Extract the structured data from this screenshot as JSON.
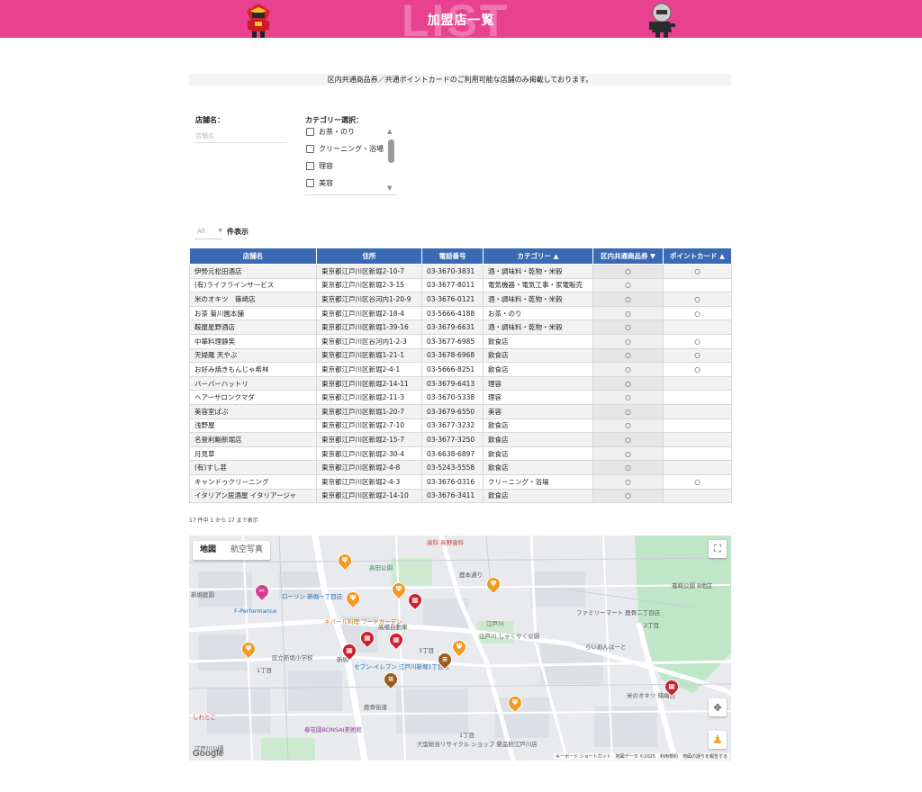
{
  "header": {
    "title": "加盟店一覧",
    "ghost_text": "LIST",
    "color": "#e8418f"
  },
  "notice": "区内共通商品券／共通ポイントカードのご利用可能な店舗のみ掲載しております。",
  "filters": {
    "name_label": "店舗名：",
    "name_placeholder": "店舗名",
    "category_label": "カテゴリー選択：",
    "categories": [
      "お茶・のり",
      "クリーニング・浴場",
      "理容",
      "美容"
    ]
  },
  "length": {
    "value": "All",
    "suffix": "件表示"
  },
  "table": {
    "headers": [
      "店舗名",
      "住所",
      "電話番号",
      "カテゴリー",
      "区内共通商品券",
      "ポイントカード"
    ],
    "rows": [
      [
        "伊勢元松田酒店",
        "東京都江戸川区新堀2-10-7",
        "03-3670-3831",
        "酒・調味料・乾物・米穀",
        "○",
        "○"
      ],
      [
        "(有)ライフラインサービス",
        "東京都江戸川区新堀2-3-15",
        "03-3677-8011",
        "電気機器・電気工事・家電販売",
        "○",
        ""
      ],
      [
        "米のオキツ　篠崎店",
        "東京都江戸川区谷河内1-20-9",
        "03-3676-0121",
        "酒・調味料・乾物・米穀",
        "○",
        "○"
      ],
      [
        "お茶 菊川園本舗",
        "東京都江戸川区新堀2-18-4",
        "03-5666-4188",
        "お茶・のり",
        "○",
        "○"
      ],
      [
        "鞍屋星野酒店",
        "東京都江戸川区新堀1-39-16",
        "03-3679-6631",
        "酒・調味料・乾物・米穀",
        "○",
        ""
      ],
      [
        "中華料理静笑",
        "東京都江戸川区谷河内1-2-3",
        "03-3677-6985",
        "飲食店",
        "○",
        "○"
      ],
      [
        "天婦羅 天やぶ",
        "東京都江戸川区新堀1-21-1",
        "03-3678-6968",
        "飲食店",
        "○",
        "○"
      ],
      [
        "お好み焼きもんじゃ希林",
        "東京都江戸川区新堀2-4-1",
        "03-5666-8251",
        "飲食店",
        "○",
        "○"
      ],
      [
        "バーバーハットリ",
        "東京都江戸川区新堀2-14-11",
        "03-3679-6413",
        "理容",
        "○",
        ""
      ],
      [
        "ヘアーサロンクマダ",
        "東京都江戸川区新堀2-11-3",
        "03-3670-5338",
        "理容",
        "○",
        ""
      ],
      [
        "美容室ぱぶ",
        "東京都江戸川区新堀1-20-7",
        "03-3679-6550",
        "美容",
        "○",
        ""
      ],
      [
        "浅野屋",
        "東京都江戸川区新堀2-7-10",
        "03-3677-3232",
        "飲食店",
        "○",
        ""
      ],
      [
        "名登利鮨新堀店",
        "東京都江戸川区新堀2-15-7",
        "03-3677-3250",
        "飲食店",
        "○",
        ""
      ],
      [
        "月見草",
        "東京都江戸川区新堀2-30-4",
        "03-6638-6897",
        "飲食店",
        "○",
        ""
      ],
      [
        "(有)すし甚",
        "東京都江戸川区新堀2-4-8",
        "03-5243-5558",
        "飲食店",
        "○",
        ""
      ],
      [
        "キャンドゥクリーニング",
        "東京都江戸川区新堀2-4-3",
        "03-3676-0316",
        "クリーニング・浴場",
        "○",
        "○"
      ],
      [
        "イタリアン居酒屋 イタリアージャ",
        "東京都江戸川区新堀2-14-10",
        "03-3676-3411",
        "飲食店",
        "○",
        ""
      ]
    ],
    "header_color": "#3a6ab3"
  },
  "info": "17 件中 1 から 17 まで表示",
  "map": {
    "tabs": [
      "地図",
      "航空写真"
    ],
    "labels": {
      "l1": "歯科 長野歯科",
      "l2": "高田公園",
      "l3": "ローソン 新堀一丁目店",
      "l4": "F-Performance",
      "l5": "ネパール料理 フードガーデン",
      "l6": "高橋自動車",
      "l7": "江戸川 しゃくやく公園",
      "l8": "ファミリーマート 鹿骨二丁目店",
      "l9": "篠崎公園 B地区",
      "l10": "らいおんはーと",
      "l11": "区立新堀小学校",
      "l12": "セブン-イレブン 江戸川新堀1丁目店",
      "l13": "米のオキツ 篠崎店",
      "l14": "春花園BONSAI美術館",
      "l15": "大型総合リサイクル ショップ 愛品館江戸川店",
      "l16": "新堀庭園",
      "l17": "鹿骨街道",
      "l18": "鹿本通り",
      "l19": "しれとこ",
      "l20": "1丁目",
      "l21": "3丁目",
      "l22": "2丁目",
      "l23": "1丁目",
      "l24": "江戸川公園",
      "l25": "新堀",
      "l26": "江戸川"
    },
    "google": "Google",
    "attribution": "キーボード ショートカット　地図データ ©2025　利用規約　地図の誤りを報告する"
  }
}
